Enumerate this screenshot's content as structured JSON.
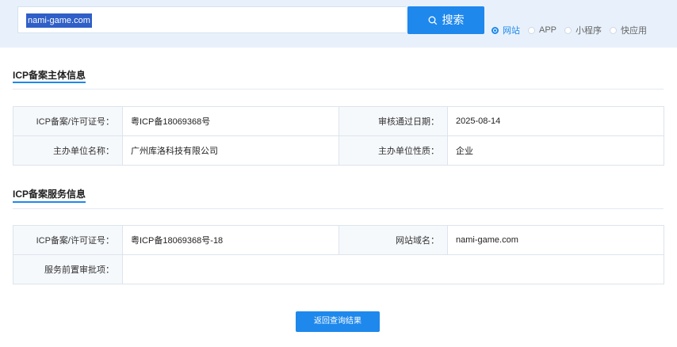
{
  "search": {
    "value": "nami-game.com",
    "button_label": "搜索"
  },
  "radio_options": [
    {
      "label": "网站",
      "selected": true
    },
    {
      "label": "APP",
      "selected": false
    },
    {
      "label": "小程序",
      "selected": false
    },
    {
      "label": "快应用",
      "selected": false
    }
  ],
  "section_main": {
    "title": "ICP备案主体信息",
    "rows": [
      {
        "label1": "ICP备案/许可证号：",
        "value1": "粤ICP备18069368号",
        "label2": "审核通过日期：",
        "value2": "2025-08-14"
      },
      {
        "label1": "主办单位名称：",
        "value1": "广州库洛科技有限公司",
        "label2": "主办单位性质：",
        "value2": "企业"
      }
    ]
  },
  "section_service": {
    "title": "ICP备案服务信息",
    "row1": {
      "label1": "ICP备案/许可证号：",
      "value1": "粤ICP备18069368号-18",
      "label2": "网站域名：",
      "value2": "nami-game.com"
    },
    "row2": {
      "label": "服务前置审批项：",
      "value": ""
    }
  },
  "back_button_label": "返回查询结果",
  "colors": {
    "accent": "#1e88ec",
    "topbar_bg": "#e8f1fb"
  }
}
